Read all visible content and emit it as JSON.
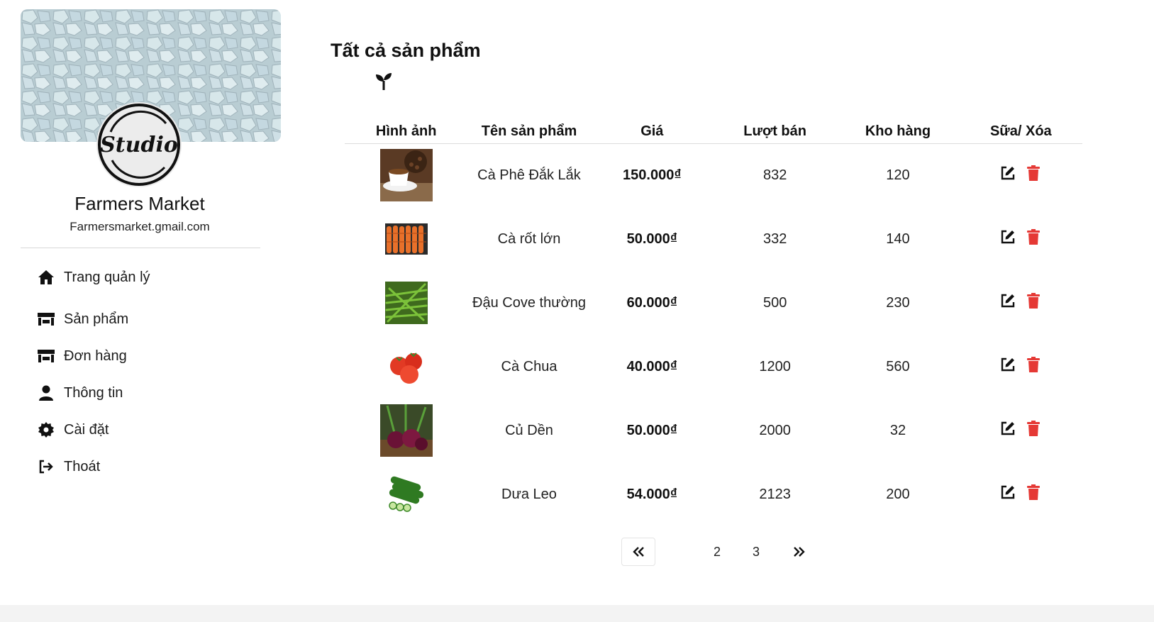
{
  "sidebar": {
    "shop_name": "Farmers Market",
    "shop_email": "Farmersmarket.gmail.com",
    "avatar_text": "Studio",
    "nav": [
      {
        "label": "Trang quản lý",
        "icon": "home-icon"
      },
      {
        "label": "Sản phẩm",
        "icon": "store-icon"
      },
      {
        "label": "Đơn hàng",
        "icon": "store-icon"
      },
      {
        "label": "Thông tin",
        "icon": "user-icon"
      },
      {
        "label": "Cài đặt",
        "icon": "gear-icon"
      },
      {
        "label": "Thoát",
        "icon": "logout-icon"
      }
    ]
  },
  "main": {
    "title": "Tất cả sản phẩm",
    "table": {
      "headers": [
        "Hình ảnh",
        "Tên sản phẩm",
        "Giá",
        "Lượt bán",
        "Kho hàng",
        "Sữa/ Xóa"
      ],
      "rows": [
        {
          "image": "coffee-image",
          "name": "Cà Phê Đắk Lắk",
          "price": "150.000₫",
          "sold": "832",
          "stock": "120"
        },
        {
          "image": "carrot-image",
          "name": "Cà rốt lớn",
          "price": "50.000₫",
          "sold": "332",
          "stock": "140"
        },
        {
          "image": "green-bean-image",
          "name": "Đậu Cove thường",
          "price": "60.000₫",
          "sold": "500",
          "stock": "230"
        },
        {
          "image": "tomato-image",
          "name": "Cà Chua",
          "price": "40.000₫",
          "sold": "1200",
          "stock": "560"
        },
        {
          "image": "beetroot-image",
          "name": "Củ Dền",
          "price": "50.000₫",
          "sold": "2000",
          "stock": "32"
        },
        {
          "image": "cucumber-image",
          "name": "Dưa Leo",
          "price": "54.000₫",
          "sold": "2123",
          "stock": "200"
        }
      ]
    },
    "pagination": {
      "prev": "«",
      "pages": [
        "2",
        "3"
      ],
      "next": "»"
    }
  },
  "colors": {
    "delete": "#e53935",
    "edit": "#111111",
    "divider": "#dcdcdc",
    "footer": "#f3f3f3"
  }
}
